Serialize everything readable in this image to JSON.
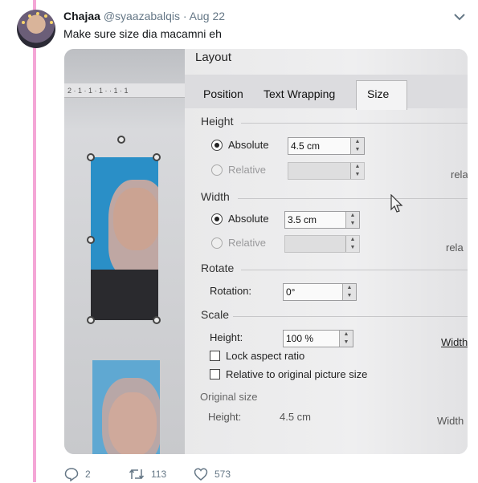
{
  "tweet": {
    "display_name": "Chajaa",
    "handle": "@syaazabalqis",
    "separator": "·",
    "date": "Aug 22",
    "text": "Make sure size dia macamni eh",
    "accent_color": "#f4a6d6"
  },
  "photo": {
    "ruler_text": "2 · 1 · 1 · 1 · · 1 · 1",
    "dialog": {
      "title": "Layout",
      "tabs": [
        "Position",
        "Text Wrapping",
        "Size"
      ],
      "active_tab": "Size",
      "height_section": {
        "title": "Height",
        "absolute_label": "Absolute",
        "absolute_value": "4.5 cm",
        "relative_label": "Relative",
        "relative_value": "",
        "relative_to_label": "rela"
      },
      "width_section": {
        "title": "Width",
        "absolute_label": "Absolute",
        "absolute_value": "3.5 cm",
        "relative_label": "Relative",
        "relative_value": "",
        "relative_to_label": "rela"
      },
      "rotate_section": {
        "title": "Rotate",
        "rotation_label": "Rotation:",
        "rotation_value": "0°"
      },
      "scale_section": {
        "title": "Scale",
        "height_label": "Height:",
        "height_value": "100 %",
        "width_label": "Width",
        "lock_aspect_label": "Lock aspect ratio",
        "relative_original_label": "Relative to original picture size"
      },
      "original_size": {
        "title": "Original size",
        "height_label": "Height:",
        "height_value": "4.5 cm",
        "width_label": "Width"
      }
    }
  },
  "actions": {
    "replies": "2",
    "retweets": "113",
    "likes": "573"
  }
}
